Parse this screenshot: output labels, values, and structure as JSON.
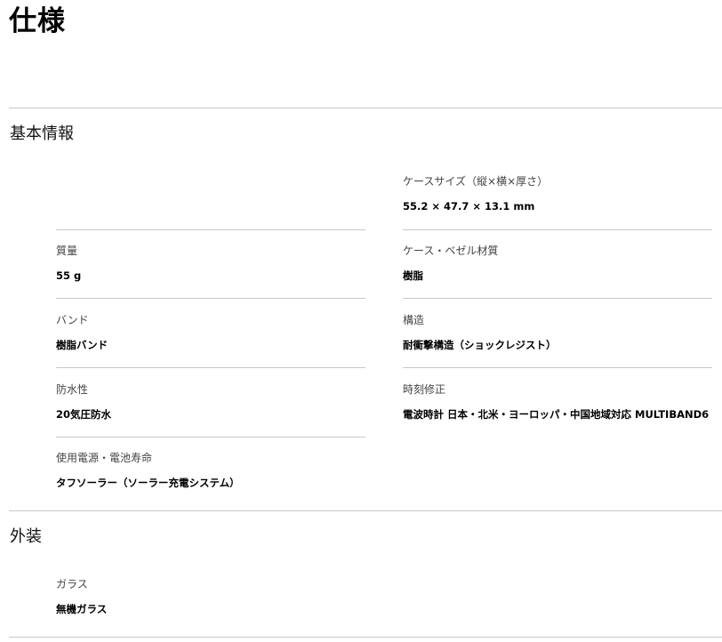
{
  "page": {
    "title": "仕様"
  },
  "sections": [
    {
      "heading": "基本情報",
      "specs": {
        "case_size": {
          "label": "ケースサイズ（縦×横×厚さ）",
          "value": "55.2 × 47.7 × 13.1 mm"
        },
        "weight": {
          "label": "質量",
          "value": "55 g"
        },
        "case_material": {
          "label": "ケース・ベゼル材質",
          "value": "樹脂"
        },
        "band": {
          "label": "バンド",
          "value": "樹脂バンド"
        },
        "structure": {
          "label": "構造",
          "value": "耐衝撃構造（ショックレジスト）"
        },
        "water_resistance": {
          "label": "防水性",
          "value": "20気圧防水"
        },
        "time_calibration": {
          "label": "時刻修正",
          "value": "電波時計 日本・北米・ヨーロッパ・中国地域対応 MULTIBAND6"
        },
        "power": {
          "label": "使用電源・電池寿命",
          "value": "タフソーラー（ソーラー充電システム）"
        }
      }
    },
    {
      "heading": "外装",
      "specs": {
        "glass": {
          "label": "ガラス",
          "value": "無機ガラス"
        }
      }
    }
  ]
}
